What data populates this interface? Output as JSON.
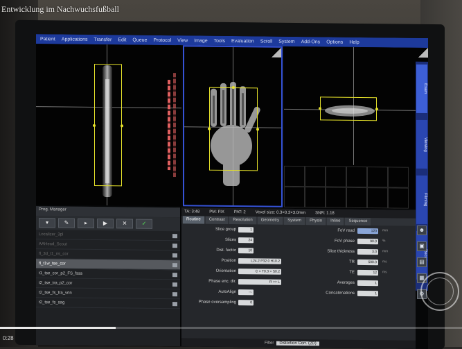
{
  "video": {
    "title": "Entwicklung im Nachwuchsfußball",
    "time": "0:28",
    "progress_fraction": 0.25
  },
  "menu": [
    "Patient",
    "Applications",
    "Transfer",
    "Edit",
    "Queue",
    "Protocol",
    "View",
    "Image",
    "Tools",
    "Evaluation",
    "Scroll",
    "System",
    "Add-Ons",
    "Options",
    "Help"
  ],
  "side_tabs": [
    "Exam",
    "Viewing",
    "Filming",
    "Recon"
  ],
  "program_list": {
    "header": "Prog. Manager",
    "items": [
      {
        "label": "Localizer_3pl",
        "state": "dim"
      },
      {
        "label": "AAHead_Scout",
        "state": "dim"
      },
      {
        "label": "fl_3d_t1_ns_cor",
        "state": "dim"
      },
      {
        "label": "fl_t1w_tse_cor",
        "state": "selected"
      },
      {
        "label": "t1_tse_cor_p2_FS_fsss",
        "state": "normal"
      },
      {
        "label": "t2_tse_tra_p2_cor",
        "state": "normal"
      },
      {
        "label": "t2_tse_fs_tra_vnn",
        "state": "normal"
      },
      {
        "label": "t2_tse_fs_sag",
        "state": "normal"
      }
    ]
  },
  "param_card": {
    "info": [
      "TA: 3:48",
      "PM: FIX",
      "PAT: 2",
      "Voxel size: 0.3×0.3×3.0mm",
      "SNR: 1.18"
    ],
    "tabs": [
      "Routine",
      "Contrast",
      "Resolution",
      "Geometry",
      "System",
      "Physio",
      "Inline",
      "Sequence"
    ],
    "left_params": [
      {
        "label": "Slice group",
        "value": "1"
      },
      {
        "label": "Slices",
        "value": "24"
      },
      {
        "label": "Dist. factor",
        "value": "10"
      },
      {
        "label": "Position",
        "value": "L24.2 P32.0 H10.2"
      },
      {
        "label": "Orientation",
        "value": "C > T0.3 > S0.2"
      },
      {
        "label": "Phase enc. dir.",
        "value": "R >> L"
      },
      {
        "label": "AutoAlign",
        "value": "---"
      },
      {
        "label": "Phase oversampling",
        "value": "0"
      }
    ],
    "right_params": [
      {
        "label": "FoV read",
        "value": "120",
        "unit": "mm"
      },
      {
        "label": "FoV phase",
        "value": "90.0",
        "unit": "%"
      },
      {
        "label": "Slice thickness",
        "value": "3.0",
        "unit": "mm"
      },
      {
        "label": "TR",
        "value": "500.0",
        "unit": "ms"
      },
      {
        "label": "TE",
        "value": "12",
        "unit": "ms"
      },
      {
        "label": "Averages",
        "value": "1",
        "unit": ""
      },
      {
        "label": "Concatenations",
        "value": "1",
        "unit": ""
      }
    ],
    "footer_label": "Filter",
    "footer_value": "Distortion Corr. (2D)"
  },
  "colors": {
    "menubar": "#1d3a9c",
    "active_border": "#3552d6",
    "graphic_box": "#e5e12a",
    "accept": "#55e055"
  }
}
